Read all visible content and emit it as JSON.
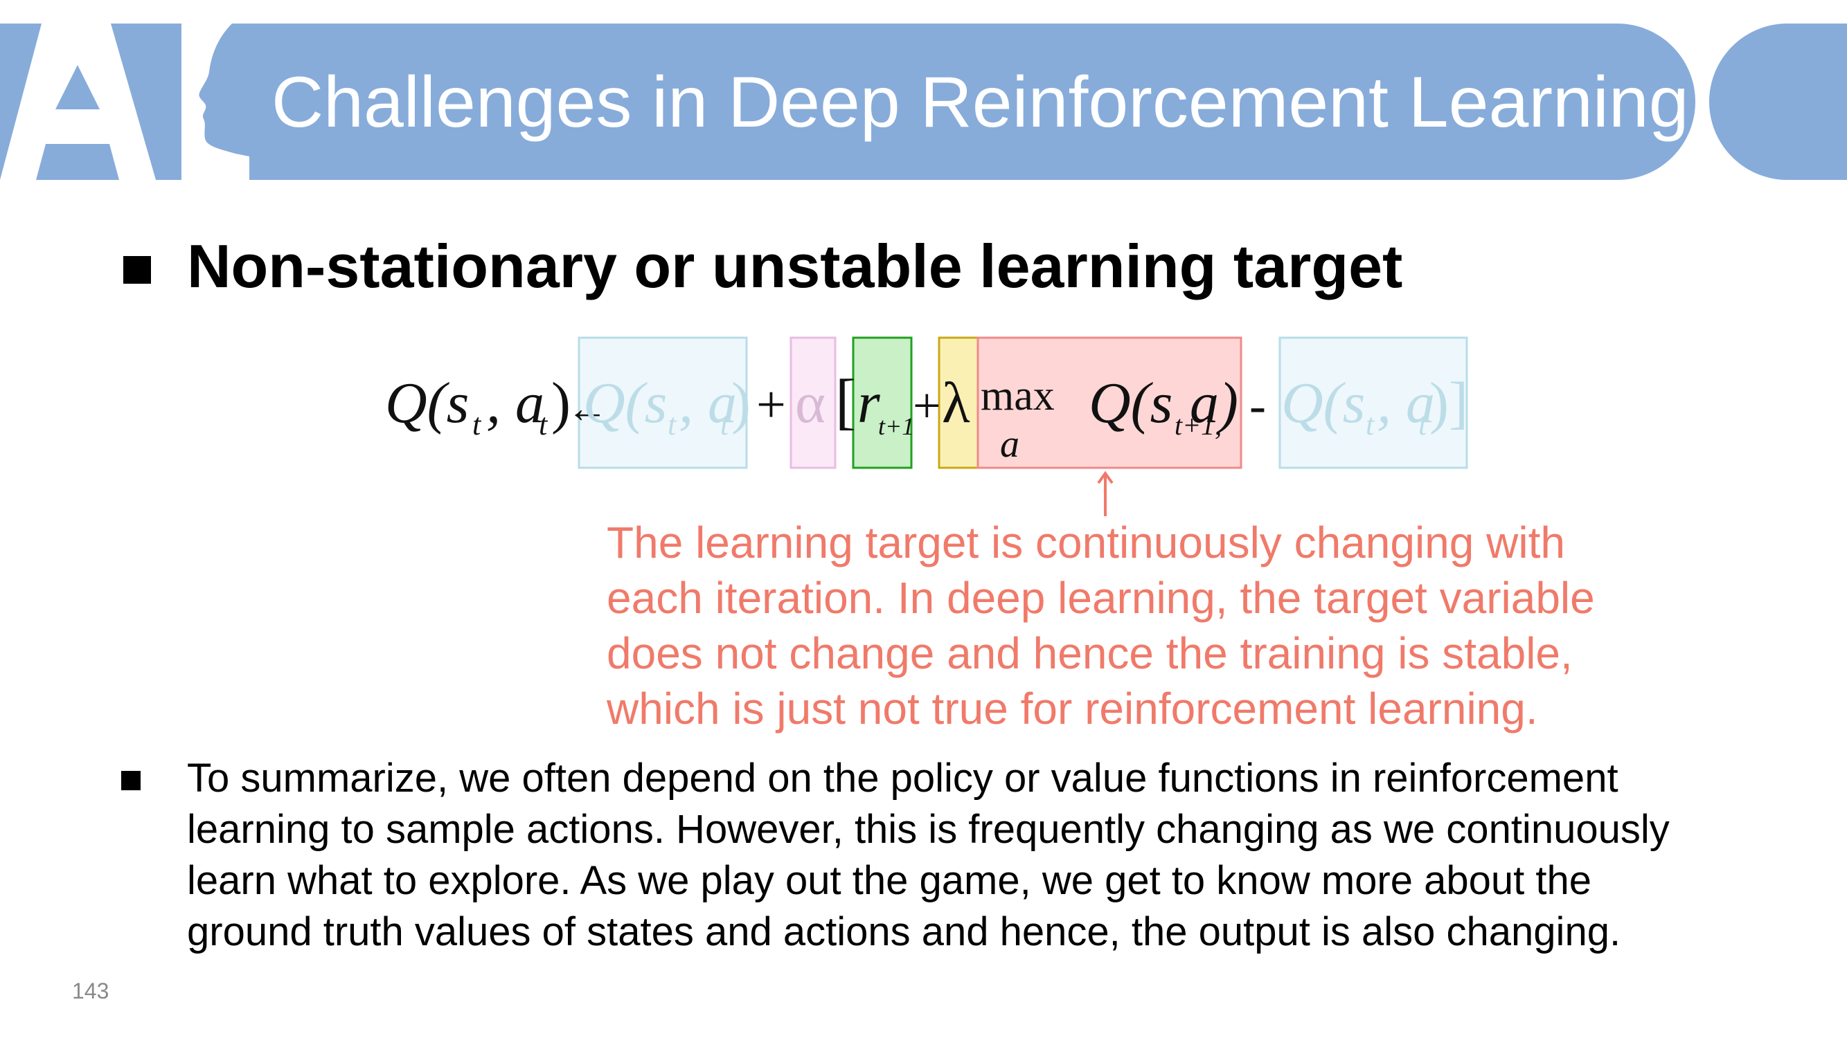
{
  "header": {
    "title": "Challenges in Deep Reinforcement Learning"
  },
  "bullet1": {
    "text": "Non-stationary or unstable learning target"
  },
  "equation": {
    "lhs": "Q(s",
    "lhs_sub": "t",
    "lhs_mid": ", a",
    "lhs_sub2": "t",
    "lhs_end": ")",
    "arrow": "←",
    "plus": "+",
    "alpha": "α",
    "bracket_open": "[",
    "r": "r",
    "r_sub": "t+1",
    "lambda": "λ",
    "max": "max",
    "max_sub": "a",
    "q_next": "Q(s",
    "q_next_sub": "t+1,",
    "q_next_end": " a)",
    "minus": "-",
    "bracket_close": "]",
    "box_colors": {
      "faded": "#eef7fb",
      "alpha": "#fbe9f7",
      "reward": "#c9f0c6",
      "lambda": "#fbf0b4",
      "target": "#ffd6d6"
    }
  },
  "annotation": {
    "lines": [
      "The learning target is continuously changing with",
      "each iteration. In deep learning, the target variable",
      "does not change and hence the training is stable,",
      "which is just not true for reinforcement learning."
    ],
    "color": "#f07a6a"
  },
  "bullet2": {
    "lines": [
      "To summarize, we often depend on the policy or value functions in reinforcement",
      "learning to sample actions. However, this is frequently changing as we continuously",
      "learn what to explore. As we play out the game, we get to know more about the",
      "ground truth values of states and actions and hence, the output is also changing."
    ]
  },
  "footer": {
    "page_number": "143"
  },
  "colors": {
    "header": "#87acda"
  }
}
